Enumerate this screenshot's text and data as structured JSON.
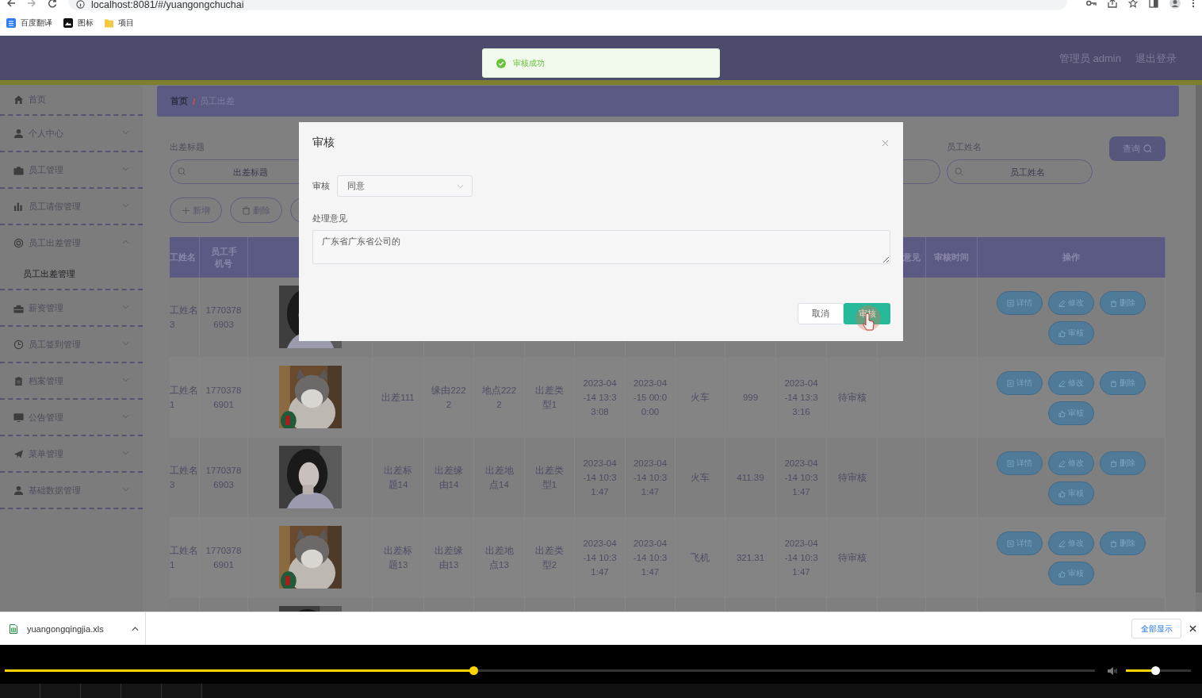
{
  "browser": {
    "address": "localhost:8081/#/yuangongchuchai",
    "bookmarks": [
      {
        "label": "百度翻译"
      },
      {
        "label": "图标"
      },
      {
        "label": "项目"
      }
    ]
  },
  "header": {
    "user": "管理员 admin",
    "logout": "退出登录"
  },
  "toast": {
    "message": "审核成功"
  },
  "sidebar": {
    "items": [
      {
        "label": "首页",
        "kind": "link"
      },
      {
        "label": "个人中心",
        "kind": "menu",
        "expanded": false
      },
      {
        "label": "员工管理",
        "kind": "menu",
        "expanded": false
      },
      {
        "label": "员工请假管理",
        "kind": "menu",
        "expanded": false
      },
      {
        "label": "员工出差管理",
        "kind": "menu",
        "expanded": true,
        "children": [
          {
            "label": "员工出差管理",
            "selected": true
          }
        ]
      },
      {
        "label": "薪资管理",
        "kind": "menu",
        "expanded": false
      },
      {
        "label": "员工签到管理",
        "kind": "menu",
        "expanded": false
      },
      {
        "label": "档案管理",
        "kind": "menu",
        "expanded": false
      },
      {
        "label": "公告管理",
        "kind": "menu",
        "expanded": false
      },
      {
        "label": "菜单管理",
        "kind": "menu",
        "expanded": false
      },
      {
        "label": "基础数据管理",
        "kind": "menu",
        "expanded": false
      }
    ]
  },
  "breadcrumb": {
    "home": "首页",
    "separator": "/",
    "current": "员工出差"
  },
  "search": {
    "fields": [
      {
        "label": "出差标题",
        "placeholder": "出差标题"
      },
      {
        "label": "员工姓名",
        "placeholder": "员工姓名"
      }
    ],
    "query_button": "查询"
  },
  "toolbar": [
    {
      "label": "新增"
    },
    {
      "label": "删除"
    }
  ],
  "table": {
    "columns_left": [
      "工姓名",
      "员工手机号"
    ],
    "columns_right": [
      "意见",
      "审核时间",
      "操作"
    ],
    "rows": [
      {
        "name": "工姓名3",
        "phone": "17703786903",
        "photo": {
          "kind": "picture"
        },
        "actions": [
          "详情",
          "修改",
          "删除",
          "审核"
        ]
      },
      {
        "name": "工姓名1",
        "phone": "17703786901",
        "photo": {
          "kind": "picture"
        },
        "details": [
          "出差111",
          "缘由2222",
          "地点2222",
          "出差类型1",
          "2023-04-14 13:33:08",
          "2023-04-15 00:00:00",
          "火车",
          "999",
          "2023-04-14 13:33:16",
          "待审核"
        ],
        "actions": [
          "详情",
          "修改",
          "删除",
          "审核"
        ]
      },
      {
        "name": "工姓名3",
        "phone": "17703786903",
        "photo": {
          "kind": "picture"
        },
        "details": [
          "出差标题14",
          "出差缘由14",
          "出差地点14",
          "出差类型1",
          "2023-04-14 10:31:47",
          "2023-04-14 10:31:47",
          "火车",
          "411.39",
          "2023-04-14 10:31:47",
          "待审核"
        ],
        "actions": [
          "详情",
          "修改",
          "删除",
          "审核"
        ]
      },
      {
        "name": "工姓名1",
        "phone": "17703786901",
        "photo": {
          "kind": "picture"
        },
        "details": [
          "出差标题13",
          "出差缘由13",
          "出差地点13",
          "出差类型2",
          "2023-04-14 10:31:47",
          "2023-04-14 10:31:47",
          "飞机",
          "321.31",
          "2023-04-14 10:31:47",
          "待审核"
        ],
        "actions": [
          "详情",
          "修改",
          "删除",
          "审核"
        ]
      },
      {
        "photo": {
          "kind": "picture"
        }
      }
    ]
  },
  "dialog": {
    "title": "审核",
    "status_label": "审核",
    "status_value": "同意",
    "opinion_label": "处理意见",
    "opinion_value": "广东省广东省公司的",
    "cancel": "取消",
    "confirm": "审核"
  },
  "downloads": {
    "file": "yuangongqingjia.xls",
    "show_all": "全部显示"
  },
  "player": {
    "progress": {
      "level": 0.43
    },
    "volume": {
      "level": 0.45
    }
  }
}
